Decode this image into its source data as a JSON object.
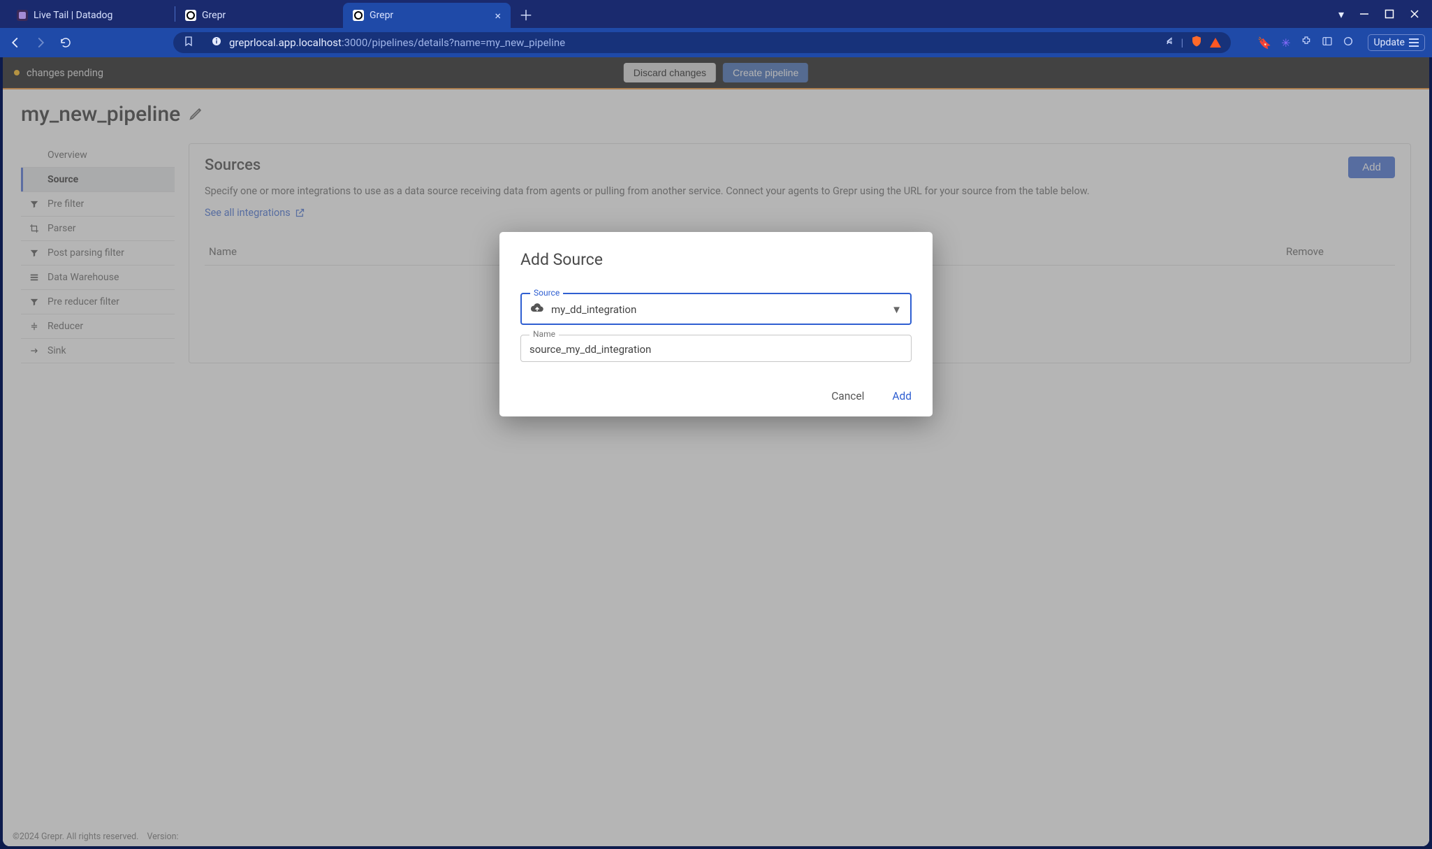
{
  "browser": {
    "tabs": [
      {
        "title": "Live Tail | Datadog",
        "active": false,
        "favicon": "dd"
      },
      {
        "title": "Grepr",
        "active": false,
        "favicon": "grepr"
      },
      {
        "title": "Grepr",
        "active": true,
        "favicon": "grepr"
      }
    ],
    "url_prefix": "greprlocal.app.localhost",
    "url_rest": ":3000/pipelines/details?name=my_new_pipeline",
    "update_label": "Update"
  },
  "changes_bar": {
    "label": "changes pending",
    "discard": "Discard changes",
    "create": "Create pipeline"
  },
  "page": {
    "title": "my_new_pipeline",
    "sidebar": {
      "items": [
        {
          "label": "Overview",
          "icon": ""
        },
        {
          "label": "Source",
          "icon": "",
          "active": true
        },
        {
          "label": "Pre filter",
          "icon": "filter"
        },
        {
          "label": "Parser",
          "icon": "crop"
        },
        {
          "label": "Post parsing filter",
          "icon": "filter"
        },
        {
          "label": "Data Warehouse",
          "icon": "stack"
        },
        {
          "label": "Pre reducer filter",
          "icon": "filter"
        },
        {
          "label": "Reducer",
          "icon": "compress"
        },
        {
          "label": "Sink",
          "icon": "arrow"
        }
      ]
    },
    "panel": {
      "heading": "Sources",
      "add_button": "Add",
      "description": "Specify one or more integrations to use as a data source receiving data from agents or pulling from another service. Connect your agents to Grepr using the URL for your source from the table below.",
      "see_link": "See all integrations",
      "table": {
        "col_name": "Name",
        "col_remove": "Remove"
      }
    }
  },
  "modal": {
    "title": "Add Source",
    "source_label": "Source",
    "source_value": "my_dd_integration",
    "name_label": "Name",
    "name_value": "source_my_dd_integration",
    "cancel": "Cancel",
    "add": "Add"
  },
  "footer": {
    "copyright": "©2024 Grepr. All rights reserved.",
    "version_label": "Version:"
  }
}
